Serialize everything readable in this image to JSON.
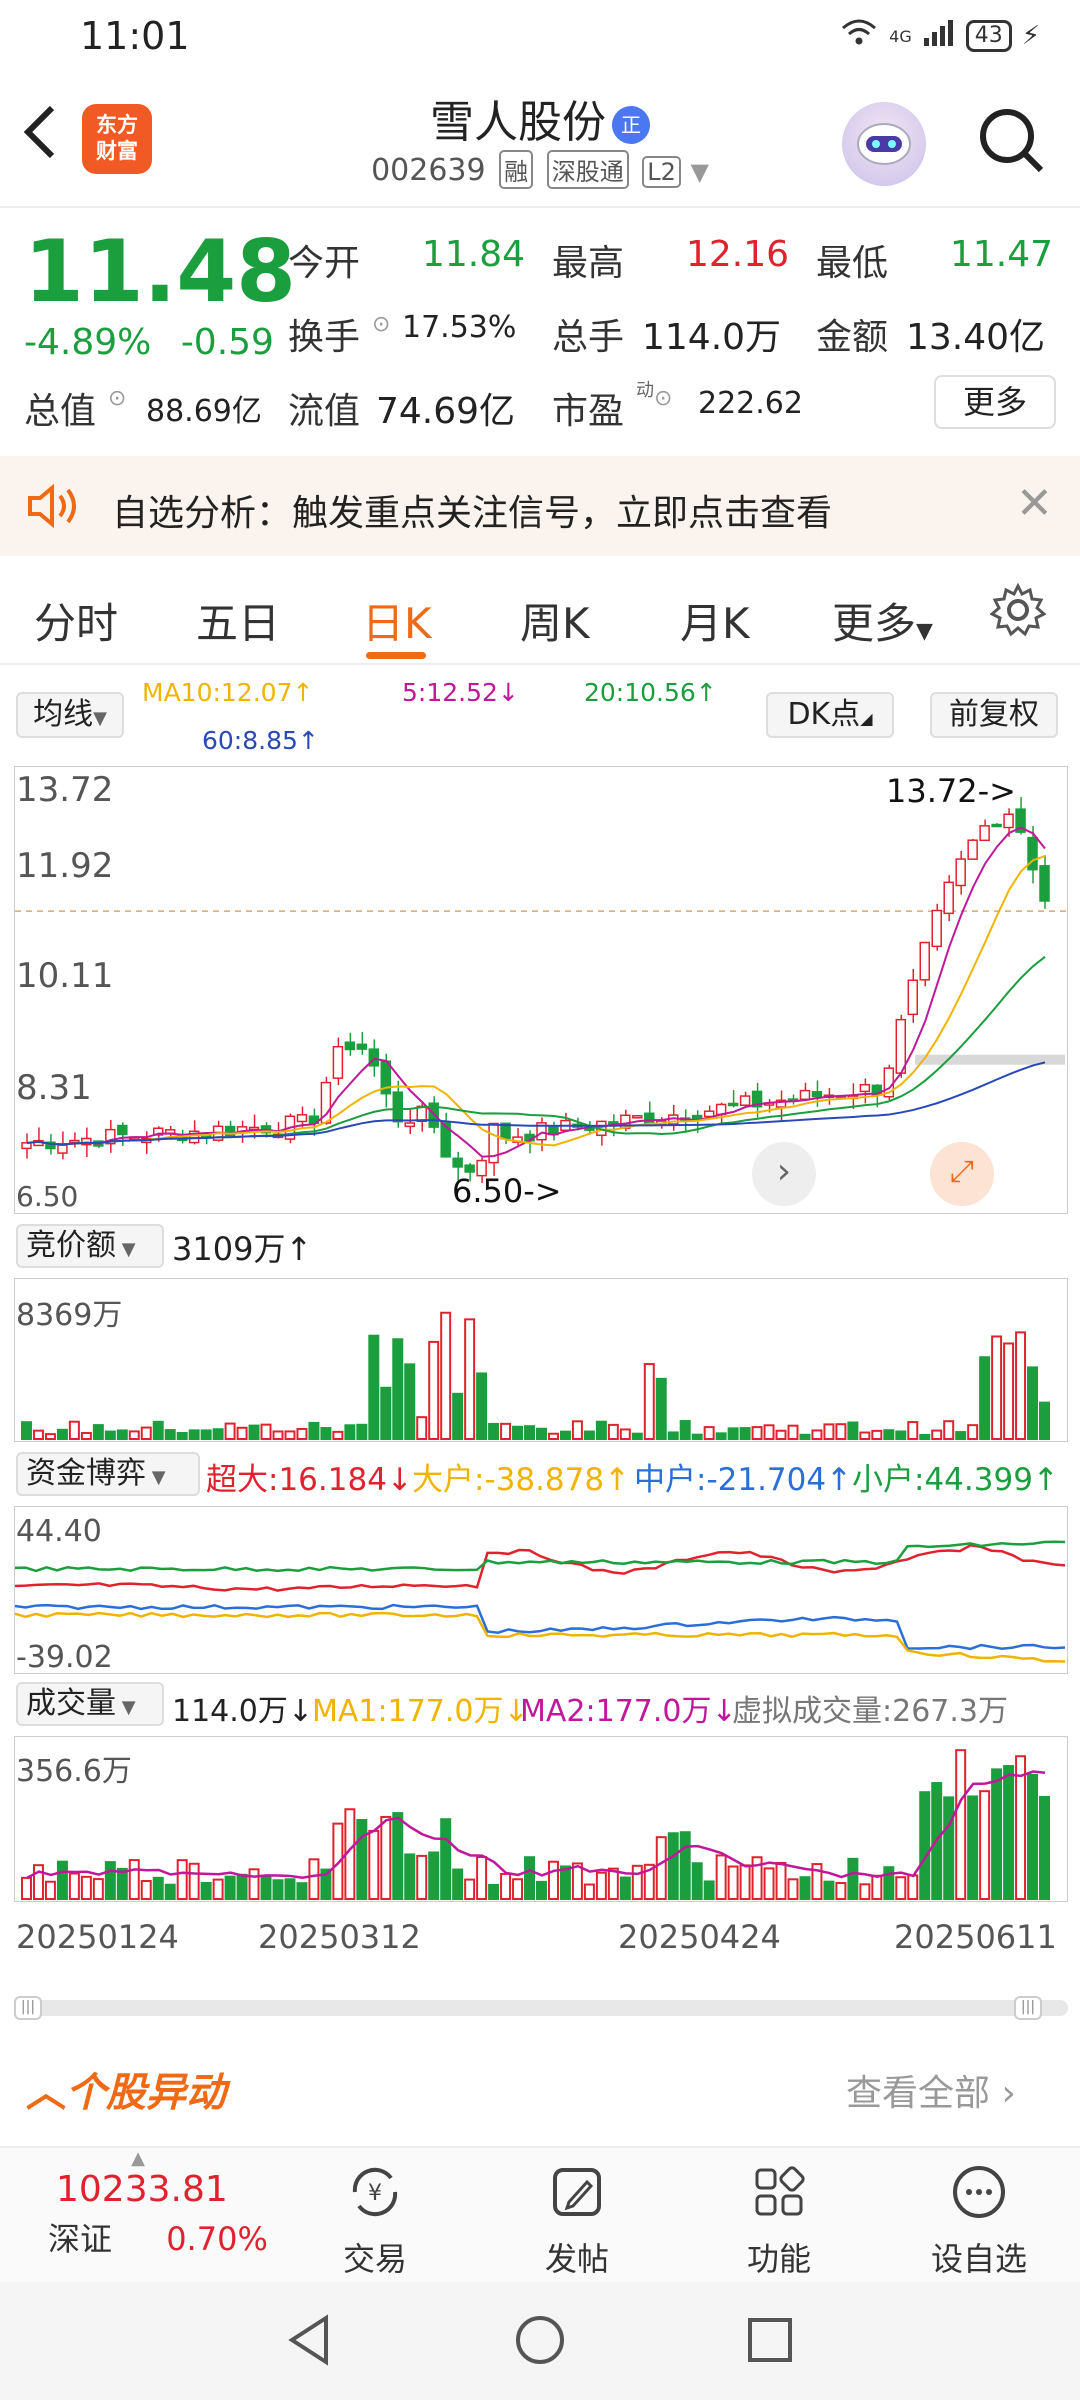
{
  "status": {
    "time": "11:01",
    "network": "4G",
    "battery": "43"
  },
  "header": {
    "logo_line1": "东方",
    "logo_line2": "财富",
    "stock_name": "雪人股份",
    "zheng_badge": "正",
    "stock_code": "002639",
    "tags": [
      "融",
      "深股通",
      "L2"
    ]
  },
  "quote": {
    "price": "11.48",
    "change_pct": "-4.89%",
    "change_amt": "-0.59",
    "open_label": "今开",
    "open": "11.84",
    "high_label": "最高",
    "high": "12.16",
    "low_label": "最低",
    "low": "11.47",
    "turnover_label": "换手",
    "turnover": "17.53%",
    "volume_label": "总手",
    "volume": "114.0万",
    "amount_label": "金额",
    "amount": "13.40亿",
    "total_cap_label": "总值",
    "total_cap": "88.69亿",
    "float_cap_label": "流值",
    "float_cap": "74.69亿",
    "pe_label": "市盈",
    "pe_sup": "动",
    "pe": "222.62",
    "more_label": "更多"
  },
  "notice": {
    "text": "自选分析：触发重点关注信号，立即点击查看"
  },
  "tabs": [
    "分时",
    "五日",
    "日K",
    "周K",
    "月K",
    "更多"
  ],
  "active_tab": "日K",
  "kline": {
    "ma_selector": "均线",
    "ma10": "MA10:12.07↑",
    "ma5": "5:12.52↓",
    "ma20": "20:10.56↑",
    "ma60": "60:8.85↑",
    "dk_button": "DK点",
    "adjust_button": "前复权",
    "y_labels": [
      "13.72",
      "11.92",
      "10.11",
      "8.31",
      "6.50"
    ],
    "high_marker": "13.72->",
    "low_marker": "6.50->",
    "colors": {
      "up": "#e0222e",
      "down": "#1b9e3e",
      "ma5": "#c0179b",
      "ma10": "#f0b400",
      "ma20": "#1b9e3e",
      "ma60": "#2a49b8"
    }
  },
  "auction": {
    "selector": "竞价额",
    "value": "3109万↑",
    "max_label": "8369万"
  },
  "capital": {
    "selector": "资金博弈",
    "super": "超大:16.184↓",
    "large": "大户:-38.878↑",
    "medium": "中户:-21.704↑",
    "small": "小户:44.399↑",
    "max_label": "44.40",
    "min_label": "-39.02"
  },
  "volume": {
    "selector": "成交量",
    "value": "114.0万↓",
    "ma1": "MA1:177.0万↓",
    "ma2": "MA2:177.0万↓",
    "virtual": "虚拟成交量:267.3万",
    "max_label": "356.6万",
    "dates": [
      "20250124",
      "20250312",
      "20250424",
      "20250611"
    ]
  },
  "alert_section": {
    "title": "个股异动",
    "view_all": "查看全部"
  },
  "bottom_nav": {
    "index_value": "10233.81",
    "index_name": "深证",
    "index_change": "0.70%",
    "items": [
      "交易",
      "发帖",
      "功能",
      "设自选"
    ]
  }
}
